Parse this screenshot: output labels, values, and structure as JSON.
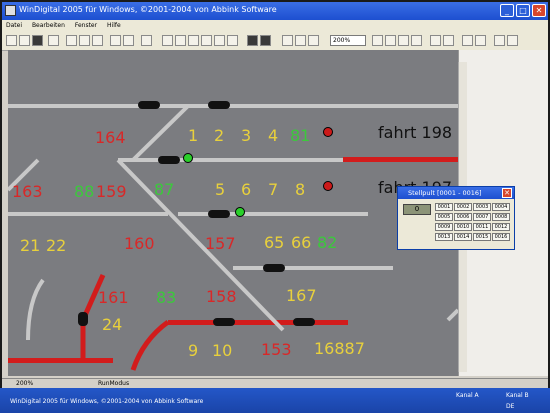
{
  "window": {
    "title": "WinDigital 2005 für Windows, ©2001-2004 von Abbink Software"
  },
  "menu": [
    "Datei",
    "Bearbeiten",
    "Fenster",
    "Hilfe"
  ],
  "toolbar": {
    "zoom": "200%"
  },
  "canvas": {
    "text_fahrt_1": "fahrt 198",
    "text_fahrt_2": "fahrt 197",
    "labels": [
      {
        "t": "164",
        "c": "r"
      },
      {
        "t": "1",
        "c": "y"
      },
      {
        "t": "2",
        "c": "y"
      },
      {
        "t": "3",
        "c": "y"
      },
      {
        "t": "4",
        "c": "y"
      },
      {
        "t": "81",
        "c": "g"
      },
      {
        "t": "163",
        "c": "r"
      },
      {
        "t": "88",
        "c": "g"
      },
      {
        "t": "159",
        "c": "r"
      },
      {
        "t": "87",
        "c": "g"
      },
      {
        "t": "5",
        "c": "y"
      },
      {
        "t": "6",
        "c": "y"
      },
      {
        "t": "7",
        "c": "y"
      },
      {
        "t": "8",
        "c": "y"
      },
      {
        "t": "21",
        "c": "y"
      },
      {
        "t": "22",
        "c": "y"
      },
      {
        "t": "160",
        "c": "r"
      },
      {
        "t": "157",
        "c": "r"
      },
      {
        "t": "65",
        "c": "y"
      },
      {
        "t": "66",
        "c": "y"
      },
      {
        "t": "82",
        "c": "g"
      },
      {
        "t": "161",
        "c": "r"
      },
      {
        "t": "83",
        "c": "g"
      },
      {
        "t": "158",
        "c": "r"
      },
      {
        "t": "167",
        "c": "y"
      },
      {
        "t": "24",
        "c": "y"
      },
      {
        "t": "9",
        "c": "y"
      },
      {
        "t": "10",
        "c": "y"
      },
      {
        "t": "153",
        "c": "r"
      },
      {
        "t": "16887",
        "c": "y"
      }
    ]
  },
  "dialog": {
    "title": "Stellpult [0001 - 0016]",
    "display": "0",
    "buttons": [
      "0001",
      "0002",
      "0003",
      "0004",
      "0005",
      "0006",
      "0007",
      "0008",
      "0009",
      "0010",
      "0011",
      "0012",
      "0013",
      "0014",
      "0015",
      "0016"
    ]
  },
  "status": {
    "zoom": "200%",
    "mode": "RunModus"
  },
  "taskbar": {
    "app": "WinDigital 2005 für Windows, ©2001-2004 von Abbink Software",
    "kanal_a": "Kanal A",
    "kanal_b": "Kanal B",
    "lang": "DE"
  },
  "colors": {
    "canvas": "#7b7c80",
    "track": "#c8c8c8",
    "red": "#d21c1c",
    "yellow": "#e8d03c",
    "green": "#3cc83c"
  }
}
